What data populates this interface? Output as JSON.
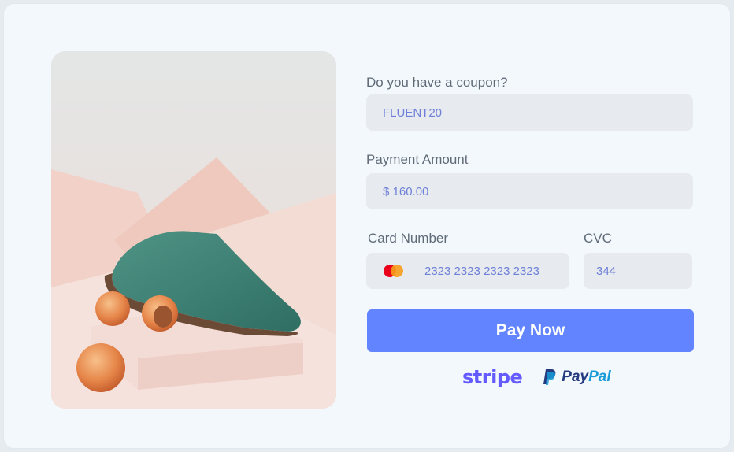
{
  "coupon": {
    "label": "Do you have a coupon?",
    "value": "FLUENT20"
  },
  "amount": {
    "label": "Payment Amount",
    "value": "$ 160.00"
  },
  "card": {
    "label": "Card Number",
    "value": "2323 2323 2323 2323",
    "brand_icon": "mastercard-icon"
  },
  "cvc": {
    "label": "CVC",
    "value": "344"
  },
  "pay_button": {
    "label": "Pay Now"
  },
  "providers": {
    "stripe": "stripe",
    "paypal_a": "Pay",
    "paypal_b": "Pal"
  },
  "colors": {
    "accent": "#6384ff",
    "field_bg": "#e7ebef",
    "field_text": "#6f80d8",
    "stripe": "#635bff",
    "paypal_dark": "#253b80",
    "paypal_light": "#179bd7"
  }
}
